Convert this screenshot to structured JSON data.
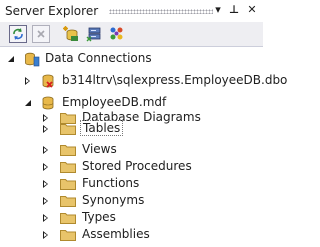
{
  "window": {
    "title": "Server Explorer",
    "pin_glyph": "⊥",
    "dropdown_glyph": "▾",
    "close_glyph": "✕"
  },
  "toolbar": {
    "buttons": [
      {
        "icon": "refresh-icon"
      },
      {
        "icon": "stop-icon"
      },
      {
        "icon": "connect-to-database-icon"
      },
      {
        "icon": "connect-to-server-icon"
      },
      {
        "icon": "connect-to-sharepoint-icon"
      }
    ]
  },
  "tree": {
    "root": {
      "label": "Data Connections",
      "icon": "data-connections-icon"
    },
    "connection_1": {
      "label": "b314ltrv\\sqlexpress.EmployeeDB.dbo",
      "icon": "database-disconnected-icon"
    },
    "connection_2": {
      "label": "EmployeeDB.mdf",
      "icon": "database-icon"
    },
    "folders": [
      {
        "label": "Database Diagrams"
      },
      {
        "label": "Tables"
      },
      {
        "label": "Views"
      },
      {
        "label": "Stored Procedures"
      },
      {
        "label": "Functions"
      },
      {
        "label": "Synonyms"
      },
      {
        "label": "Types"
      },
      {
        "label": "Assemblies"
      }
    ],
    "selected": "Tables"
  },
  "colors": {
    "folder_fill": "#e8c46a",
    "folder_edge": "#b08a2e",
    "database_fill": "#e8b84a",
    "accent_blue": "#3a7fd0"
  }
}
